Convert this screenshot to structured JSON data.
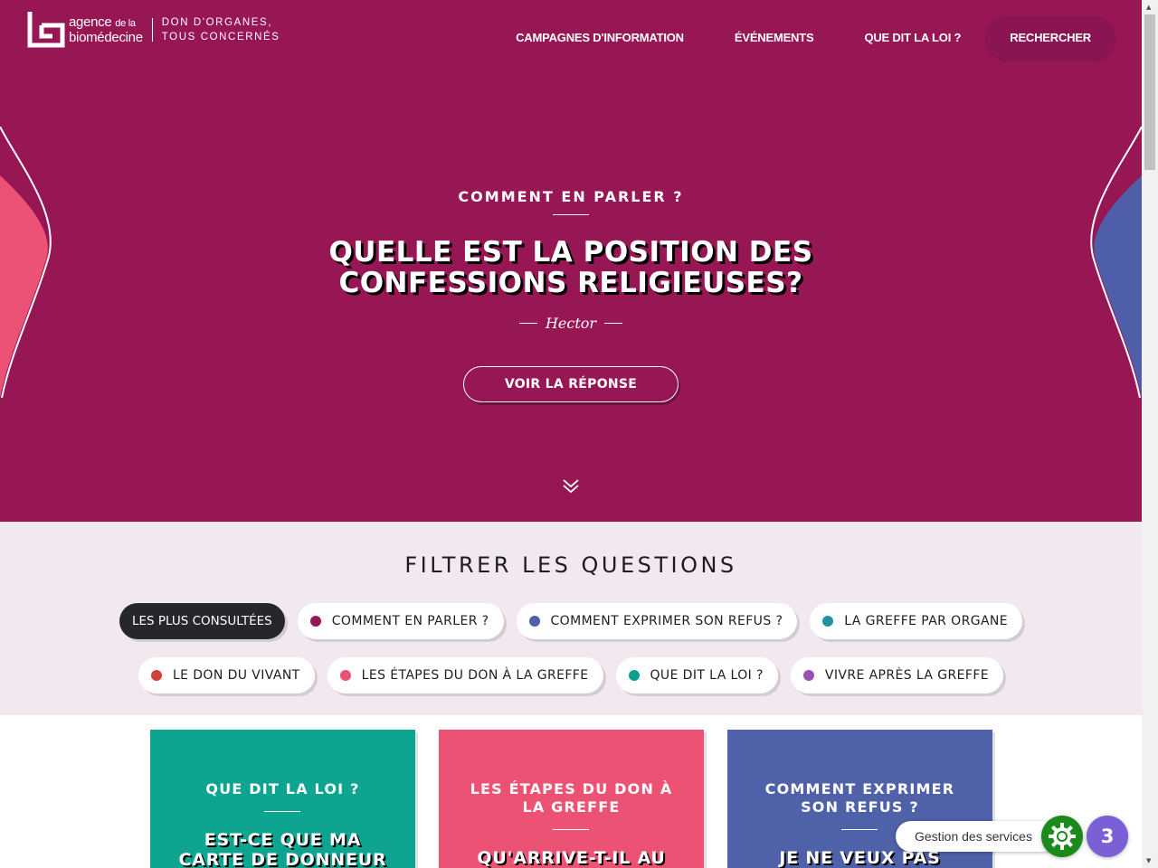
{
  "header": {
    "logo_agency_line1": "agence",
    "logo_agency_small": "de la",
    "logo_agency_line2": "biomédecine",
    "logo_tag_line1": "DON D'ORGANES,",
    "logo_tag_line2": "TOUS CONCERNÉS",
    "nav": [
      {
        "label": "CAMPAGNES D'INFORMATION"
      },
      {
        "label": "ÉVÉNEMENTS"
      },
      {
        "label": "QUE DIT LA LOI ?"
      }
    ],
    "search_label": "RECHERCHER"
  },
  "hero": {
    "eyebrow": "COMMENT EN PARLER ?",
    "title_line1": "QUELLE EST LA POSITION DES",
    "title_line2": "CONFESSIONS RELIGIEUSES?",
    "author": "Hector",
    "button_label": "VOIR LA RÉPONSE",
    "scroll_icon": "double-chevron-down-icon"
  },
  "filters": {
    "title": "FILTRER LES QUESTIONS",
    "row1": [
      {
        "label": "LES PLUS CONSULTÉES",
        "active": true,
        "color": ""
      },
      {
        "label": "COMMENT EN PARLER ?",
        "color": "#971654"
      },
      {
        "label": "COMMENT EXPRIMER SON REFUS ?",
        "color": "#4e5ea8"
      },
      {
        "label": "LA GREFFE PAR ORGANE",
        "color": "#20919e"
      }
    ],
    "row2": [
      {
        "label": "LE DON DU VIVANT",
        "color": "#d0413a"
      },
      {
        "label": "LES ÉTAPES DU DON À LA GREFFE",
        "color": "#ec5275"
      },
      {
        "label": "QUE DIT LA LOI ?",
        "color": "#0ea08f"
      },
      {
        "label": "VIVRE APRÈS LA GREFFE",
        "color": "#9b4fb0"
      }
    ]
  },
  "cards": [
    {
      "category": "QUE DIT LA LOI ?",
      "question_line1": "EST-CE QUE MA",
      "question_line2": "CARTE DE DONNEUR",
      "color": "#0ea590"
    },
    {
      "category": "LES ÉTAPES DU DON À LA GREFFE",
      "question_line1": "QU'ARRIVE-T-IL AU",
      "question_line2": "",
      "color": "#ec5273"
    },
    {
      "category": "COMMENT EXPRIMER SON REFUS ?",
      "question_line1": "JE NE VEUX PAS",
      "question_line2": "",
      "color": "#4f62a9"
    }
  ],
  "cookies": {
    "label": "Gestion des services",
    "count": "3"
  },
  "colors": {
    "brand": "#971654",
    "filters_bg": "#f1e9ef",
    "left_wave": "#ec5275",
    "right_wave": "#4e5ea8"
  }
}
